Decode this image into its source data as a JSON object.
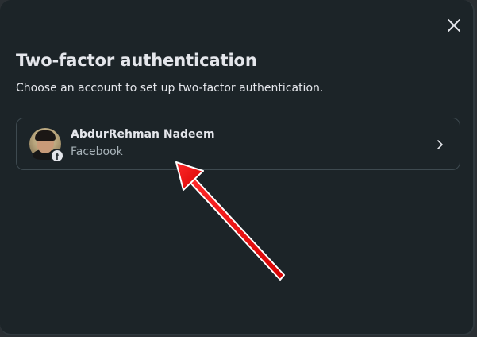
{
  "dialog": {
    "title": "Two-factor authentication",
    "subtitle": "Choose an account to set up two-factor authentication.",
    "close_icon": "close-icon"
  },
  "account": {
    "name": "AbdurRehman Nadeem",
    "platform": "Facebook",
    "badge_glyph": "f",
    "badge_icon": "facebook-icon",
    "chevron_icon": "chevron-right-icon"
  },
  "annotation": {
    "arrow_color": "#ff1a1a",
    "arrow_icon": "red-arrow-annotation"
  },
  "colors": {
    "dialog_bg": "#1c2428",
    "text_primary": "#e4e6eb",
    "text_secondary": "#a8b3b9",
    "card_border": "#3e4a50"
  }
}
